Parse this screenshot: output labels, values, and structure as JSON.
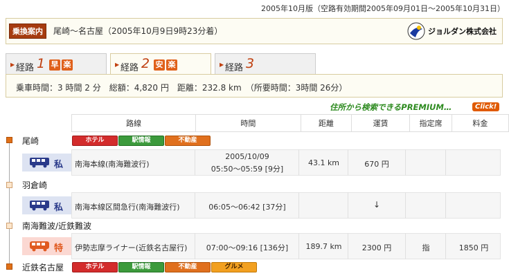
{
  "edition": "2005年10月版（空路有効期間2005年09月01日～2005年10月31日）",
  "header": {
    "tag": "乗換案内",
    "title": "尾崎～名古屋（2005年10月9日9時23分着）",
    "logo_text": "ジョルダン株式会社"
  },
  "tabs": [
    {
      "label": "経路",
      "num": "1",
      "badges": [
        "早",
        "楽"
      ]
    },
    {
      "label": "経路",
      "num": "2",
      "badges": [
        "安",
        "楽"
      ]
    },
    {
      "label": "経路",
      "num": "3",
      "badges": []
    }
  ],
  "summary": "乗車時間：3 時間 2 分　総額：4,820 円　距離：232.8 km　（所要時間：3時間 26分）",
  "premium": {
    "text": "住所から検索できるPREMIUM…",
    "click": "Click!"
  },
  "table": {
    "headers": [
      "路線",
      "時間",
      "距離",
      "運賃",
      "指定席",
      "料金"
    ]
  },
  "station_buttons": {
    "hotel": "ホテル",
    "station_info": "駅情報",
    "realestate": "不動産",
    "gourmet": "グルメ"
  },
  "stations": [
    {
      "name": "尾崎"
    },
    {
      "name": "羽倉崎"
    },
    {
      "name": "南海難波/近鉄難波"
    },
    {
      "name": "近鉄名古屋"
    }
  ],
  "segments": [
    {
      "type_label": "私",
      "line": "南海本線(南海難波行)",
      "date": "2005/10/09",
      "time": "05:50～05:59 [9分]",
      "distance": "43.1 km",
      "fare": "670 円",
      "reserved": "",
      "charge": ""
    },
    {
      "type_label": "私",
      "line": "南海本線区間急行(南海難波行)",
      "date": "",
      "time": "06:05～06:42 [37分]",
      "distance": "",
      "fare": "↓",
      "reserved": "",
      "charge": ""
    },
    {
      "type_label": "特",
      "line": "伊勢志摩ライナー(近鉄名古屋行)",
      "date": "",
      "time": "07:00～09:16 [136分]",
      "distance": "189.7 km",
      "fare": "2300 円",
      "reserved": "指",
      "charge": "1850 円"
    }
  ],
  "colors": {
    "accent": "#c04010",
    "brand_green": "#2e8b20",
    "header_tag": "#a63b10"
  }
}
